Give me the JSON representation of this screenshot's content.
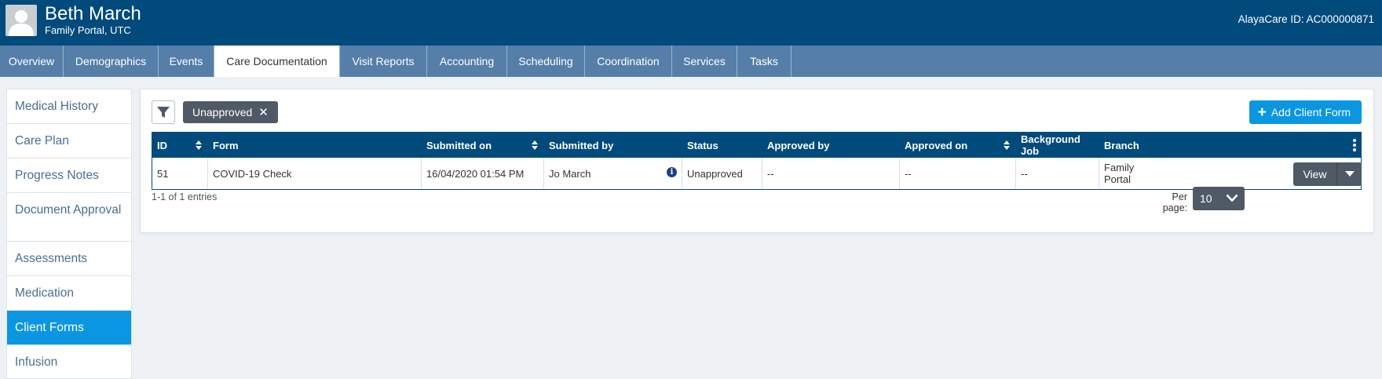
{
  "header": {
    "client_name": "Beth March",
    "client_subtitle": "Family Portal, UTC",
    "client_id": "AlayaCare ID: AC000000871",
    "bg_color": "#004a7c"
  },
  "tabs": [
    {
      "label": "Overview"
    },
    {
      "label": "Demographics"
    },
    {
      "label": "Events"
    },
    {
      "label": "Care Documentation",
      "active": true
    },
    {
      "label": "Visit Reports"
    },
    {
      "label": "Accounting"
    },
    {
      "label": "Scheduling"
    },
    {
      "label": "Coordination"
    },
    {
      "label": "Services"
    },
    {
      "label": "Tasks"
    }
  ],
  "sidebar": {
    "items": [
      {
        "label": "Medical History"
      },
      {
        "label": "Care Plan"
      },
      {
        "label": "Progress Notes"
      },
      {
        "label": "Document Approval"
      },
      {
        "label": "Assessments"
      },
      {
        "label": "Medication"
      },
      {
        "label": "Client Forms",
        "active": true
      },
      {
        "label": "Infusion"
      }
    ],
    "active_color": "#0b96e2"
  },
  "toolbar": {
    "filter_icon": "funnel-icon",
    "active_filter": "Unapproved",
    "add_button": "Add Client Form"
  },
  "table": {
    "columns": [
      "ID",
      "Form",
      "Submitted on",
      "Submitted by",
      "Status",
      "Approved by",
      "Approved on",
      "Background Job",
      "Branch"
    ],
    "rows": [
      {
        "id": "51",
        "form": "COVID-19 Check",
        "submitted_on": "16/04/2020 01:54 PM",
        "submitted_by": "Jo March",
        "status": "Unapproved",
        "approved_by": "--",
        "approved_on": "--",
        "background_job": "--",
        "branch": "Family Portal",
        "action": "View"
      }
    ]
  },
  "footer": {
    "entries": "1-1 of 1 entries",
    "per_page_label": "Per page:",
    "per_page_value": "10"
  }
}
